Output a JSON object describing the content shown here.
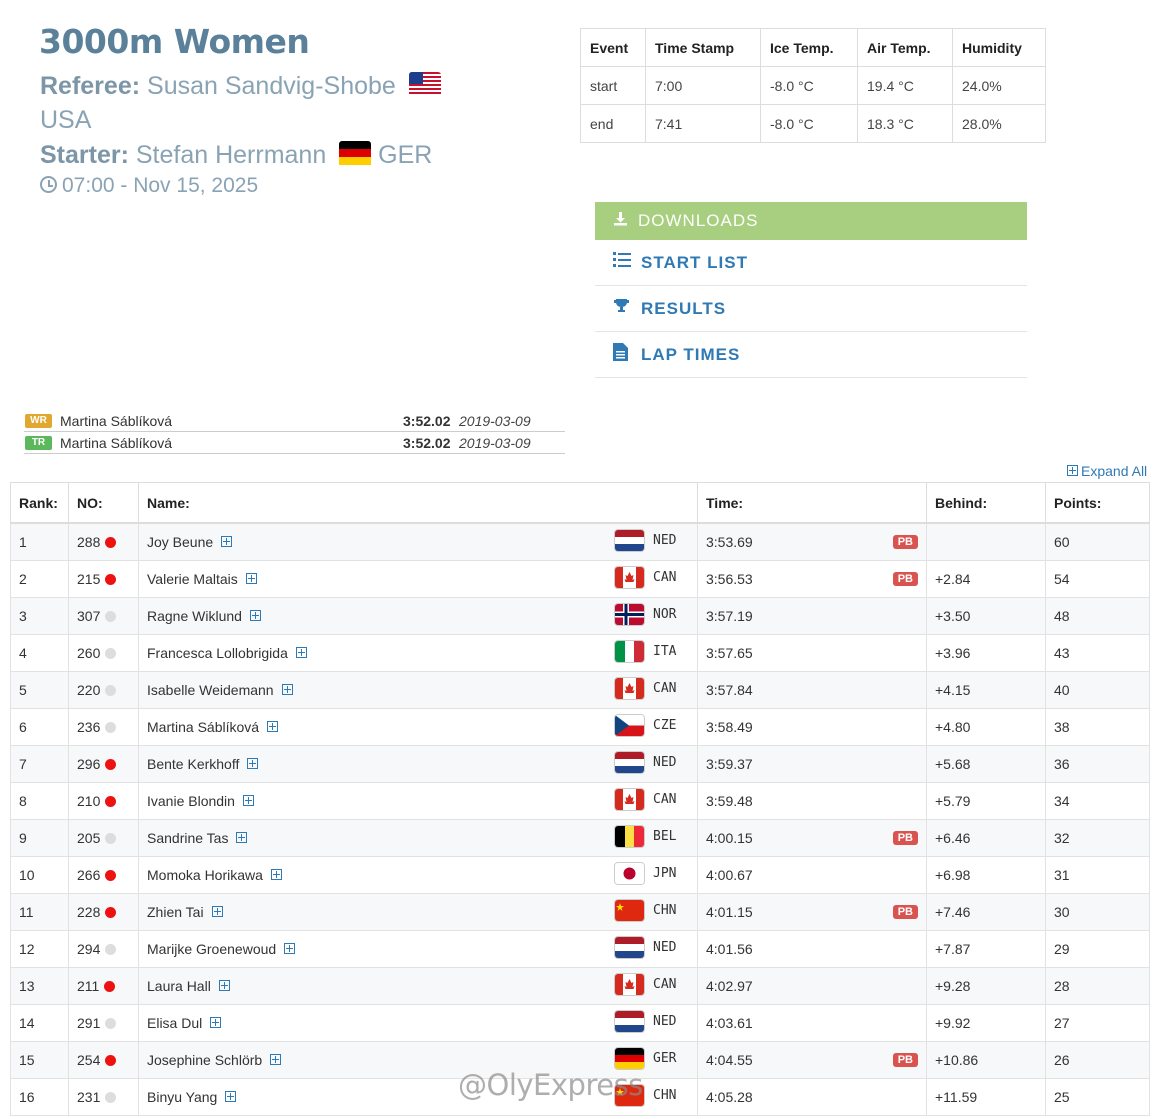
{
  "event": {
    "title": "3000m Women",
    "referee_label": "Referee:",
    "referee_name": "Susan Sandvig-Shobe",
    "referee_country": "USA",
    "starter_label": "Starter:",
    "starter_name": "Stefan Herrmann",
    "starter_country": "GER",
    "datetime": "07:00 - Nov 15, 2025"
  },
  "weather": {
    "headers": [
      "Event",
      "Time Stamp",
      "Ice Temp.",
      "Air Temp.",
      "Humidity"
    ],
    "rows": [
      [
        "start",
        "7:00",
        "-8.0 °C",
        "19.4 °C",
        "24.0%"
      ],
      [
        "end",
        "7:41",
        "-8.0 °C",
        "18.3 °C",
        "28.0%"
      ]
    ]
  },
  "downloads": {
    "header": "DOWNLOADS",
    "items": [
      {
        "label": "START LIST",
        "icon": "list-numbered-icon"
      },
      {
        "label": "RESULTS",
        "icon": "trophy-icon"
      },
      {
        "label": "LAP TIMES",
        "icon": "document-icon"
      }
    ]
  },
  "records": [
    {
      "badge": "WR",
      "color": "#e1a830",
      "name": "Martina Sáblíková",
      "time": "3:52.02",
      "date": "2019-03-09"
    },
    {
      "badge": "TR",
      "color": "#5cb85c",
      "name": "Martina Sáblíková",
      "time": "3:52.02",
      "date": "2019-03-09"
    }
  ],
  "expand_all": "Expand All",
  "results": {
    "headers": [
      "Rank:",
      "NO:",
      "Name:",
      "Time:",
      "Behind:",
      "Points:"
    ],
    "rows": [
      {
        "rank": "1",
        "no": "288",
        "dot": "red",
        "name": "Joy Beune",
        "country": "NED",
        "time": "3:53.69",
        "pb": "PB",
        "behind": "",
        "points": "60"
      },
      {
        "rank": "2",
        "no": "215",
        "dot": "red",
        "name": "Valerie Maltais",
        "country": "CAN",
        "time": "3:56.53",
        "pb": "PB",
        "behind": "+2.84",
        "points": "54"
      },
      {
        "rank": "3",
        "no": "307",
        "dot": "grey",
        "name": "Ragne Wiklund",
        "country": "NOR",
        "time": "3:57.19",
        "pb": "",
        "behind": "+3.50",
        "points": "48"
      },
      {
        "rank": "4",
        "no": "260",
        "dot": "grey",
        "name": "Francesca Lollobrigida",
        "country": "ITA",
        "time": "3:57.65",
        "pb": "",
        "behind": "+3.96",
        "points": "43"
      },
      {
        "rank": "5",
        "no": "220",
        "dot": "grey",
        "name": "Isabelle Weidemann",
        "country": "CAN",
        "time": "3:57.84",
        "pb": "",
        "behind": "+4.15",
        "points": "40"
      },
      {
        "rank": "6",
        "no": "236",
        "dot": "grey",
        "name": "Martina Sáblíková",
        "country": "CZE",
        "time": "3:58.49",
        "pb": "",
        "behind": "+4.80",
        "points": "38"
      },
      {
        "rank": "7",
        "no": "296",
        "dot": "red",
        "name": "Bente Kerkhoff",
        "country": "NED",
        "time": "3:59.37",
        "pb": "",
        "behind": "+5.68",
        "points": "36"
      },
      {
        "rank": "8",
        "no": "210",
        "dot": "red",
        "name": "Ivanie Blondin",
        "country": "CAN",
        "time": "3:59.48",
        "pb": "",
        "behind": "+5.79",
        "points": "34"
      },
      {
        "rank": "9",
        "no": "205",
        "dot": "grey",
        "name": "Sandrine Tas",
        "country": "BEL",
        "time": "4:00.15",
        "pb": "PB",
        "behind": "+6.46",
        "points": "32"
      },
      {
        "rank": "10",
        "no": "266",
        "dot": "red",
        "name": "Momoka Horikawa",
        "country": "JPN",
        "time": "4:00.67",
        "pb": "",
        "behind": "+6.98",
        "points": "31"
      },
      {
        "rank": "11",
        "no": "228",
        "dot": "red",
        "name": "Zhien Tai",
        "country": "CHN",
        "time": "4:01.15",
        "pb": "PB",
        "behind": "+7.46",
        "points": "30"
      },
      {
        "rank": "12",
        "no": "294",
        "dot": "grey",
        "name": "Marijke Groenewoud",
        "country": "NED",
        "time": "4:01.56",
        "pb": "",
        "behind": "+7.87",
        "points": "29"
      },
      {
        "rank": "13",
        "no": "211",
        "dot": "red",
        "name": "Laura Hall",
        "country": "CAN",
        "time": "4:02.97",
        "pb": "",
        "behind": "+9.28",
        "points": "28"
      },
      {
        "rank": "14",
        "no": "291",
        "dot": "grey",
        "name": "Elisa Dul",
        "country": "NED",
        "time": "4:03.61",
        "pb": "",
        "behind": "+9.92",
        "points": "27"
      },
      {
        "rank": "15",
        "no": "254",
        "dot": "red",
        "name": "Josephine Schlörb",
        "country": "GER",
        "time": "4:04.55",
        "pb": "PB",
        "behind": "+10.86",
        "points": "26"
      },
      {
        "rank": "16",
        "no": "231",
        "dot": "grey",
        "name": "Binyu Yang",
        "country": "CHN",
        "time": "4:05.28",
        "pb": "",
        "behind": "+11.59",
        "points": "25"
      }
    ]
  },
  "watermark": "@OlyExpress",
  "colors": {
    "red_dot": "#ee1111",
    "grey_dot": "#dddddd",
    "accent": "#2f79b5",
    "downloads_bg": "#a8cf7f",
    "pb": "#d9534f"
  }
}
